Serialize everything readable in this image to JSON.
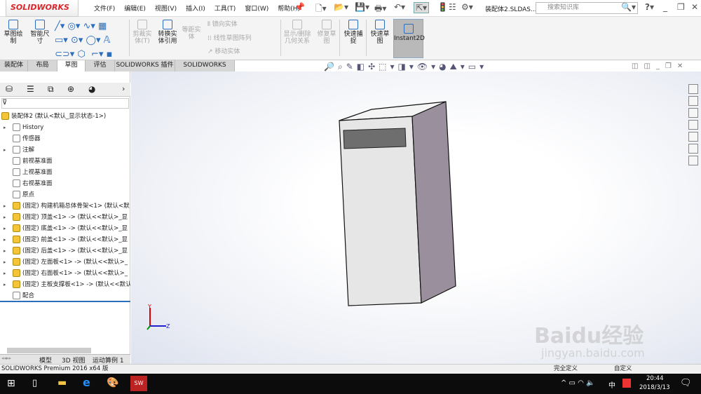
{
  "app": {
    "logo": "SOLIDWORKS",
    "doc_title": "装配体2.SLDAS...",
    "search_placeholder": "搜索知识库"
  },
  "menu": [
    "文件(F)",
    "编辑(E)",
    "视图(V)",
    "插入(I)",
    "工具(T)",
    "窗口(W)",
    "帮助(H)"
  ],
  "ribbon": {
    "sketch": "草图绘制",
    "smart_dim": "智能尺寸",
    "trim": "剪裁实体(T)",
    "convert": "转换实体引用",
    "offset": "等距实体",
    "mirror": "镜向实体",
    "linear_pattern": "线性草图阵列",
    "move": "移动实体",
    "show_rel": "显示/删除几何关系",
    "repair": "修复草图",
    "quick_snap": "快速捕捉",
    "rapid_sketch": "快速草图",
    "instant2d": "Instant2D"
  },
  "tabs": [
    "装配体",
    "布局",
    "草图",
    "评估",
    "SOLIDWORKS 插件",
    "SOLIDWORKS MBD"
  ],
  "active_tab": 2,
  "tree": {
    "root": "装配体2 (默认<默认_显示状态-1>)",
    "items": [
      {
        "label": "History",
        "expand": true,
        "icon": "history-icon"
      },
      {
        "label": "传感器",
        "expand": false,
        "icon": "sensor-icon"
      },
      {
        "label": "注解",
        "expand": true,
        "icon": "annotation-icon"
      },
      {
        "label": "前视基准面",
        "expand": false,
        "icon": "plane-icon"
      },
      {
        "label": "上视基准面",
        "expand": false,
        "icon": "plane-icon"
      },
      {
        "label": "右视基准面",
        "expand": false,
        "icon": "plane-icon"
      },
      {
        "label": "原点",
        "expand": false,
        "icon": "origin-icon"
      },
      {
        "label": "(固定) 构建机箱总体骨架<1> (默认<默",
        "expand": true,
        "icon": "assembly-icon"
      },
      {
        "label": "(固定) 顶盖<1> -> (默认<<默认>_显",
        "expand": true,
        "icon": "part-icon"
      },
      {
        "label": "(固定) 底盖<1> -> (默认<<默认>_显",
        "expand": true,
        "icon": "part-icon"
      },
      {
        "label": "(固定) 前盖<1> -> (默认<<默认>_显",
        "expand": true,
        "icon": "part-icon"
      },
      {
        "label": "(固定) 后盖<1> -> (默认<<默认>_显",
        "expand": true,
        "icon": "part-icon"
      },
      {
        "label": "(固定) 左面板<1> -> (默认<<默认>_",
        "expand": true,
        "icon": "part-icon"
      },
      {
        "label": "(固定) 右面板<1> -> (默认<<默认>_",
        "expand": true,
        "icon": "part-icon"
      },
      {
        "label": "(固定) 主板支撑板<1> -> (默认<<默认",
        "expand": true,
        "icon": "subassembly-icon"
      },
      {
        "label": "配合",
        "expand": false,
        "icon": "mate-icon"
      }
    ]
  },
  "bottom_tabs": [
    "模型",
    "3D 视图",
    "运动算例 1"
  ],
  "status": {
    "text": "SOLIDWORKS Premium 2016 x64 版",
    "right1": "完全定义",
    "right2": "自定义"
  },
  "triad": {
    "y": "Y",
    "z": "Z"
  },
  "taskbar": {
    "time": "20:44",
    "date": "2018/3/13",
    "ime": "中"
  },
  "watermark": {
    "brand": "Baidu经验",
    "url": "jingyan.baidu.com"
  },
  "colors": {
    "accent": "#2a6ebd",
    "brand_red": "#d9262c",
    "box_side": "#9a8f9c",
    "box_front": "#e6e6e6"
  }
}
